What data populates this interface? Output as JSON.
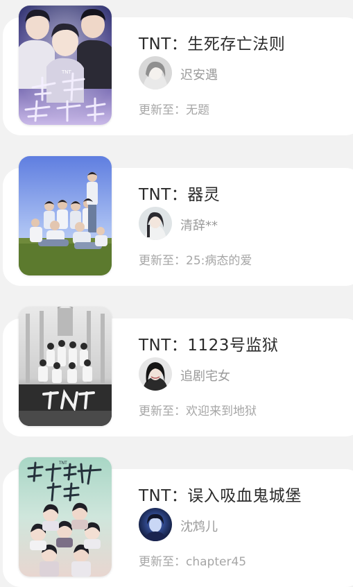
{
  "books": [
    {
      "title": "TNT：生死存亡法则",
      "cover_icon": "cover-image-three-boys-purple",
      "author": "迟安遇",
      "update_label": "更新至：",
      "update_value": "无题"
    },
    {
      "title": "TNT：器灵",
      "cover_icon": "cover-image-group-on-grass",
      "author": "清辞**",
      "update_label": "更新至：",
      "update_value": "25:病态的爱"
    },
    {
      "title": "TNT：1123号监狱",
      "cover_icon": "cover-image-grey-stage",
      "author": "追剧宅女",
      "update_label": "更新至：",
      "update_value": "欢迎来到地狱"
    },
    {
      "title": "TNT：误入吸血鬼城堡",
      "cover_icon": "cover-image-vampire-castle",
      "author": "沈鸩儿",
      "update_label": "更新至：",
      "update_value": "chapter45"
    }
  ],
  "colors": {
    "page_background": "#f2f2f2",
    "card_background": "#ffffff",
    "title_text": "#2b2b2b",
    "meta_text": "#a6a6a6"
  }
}
